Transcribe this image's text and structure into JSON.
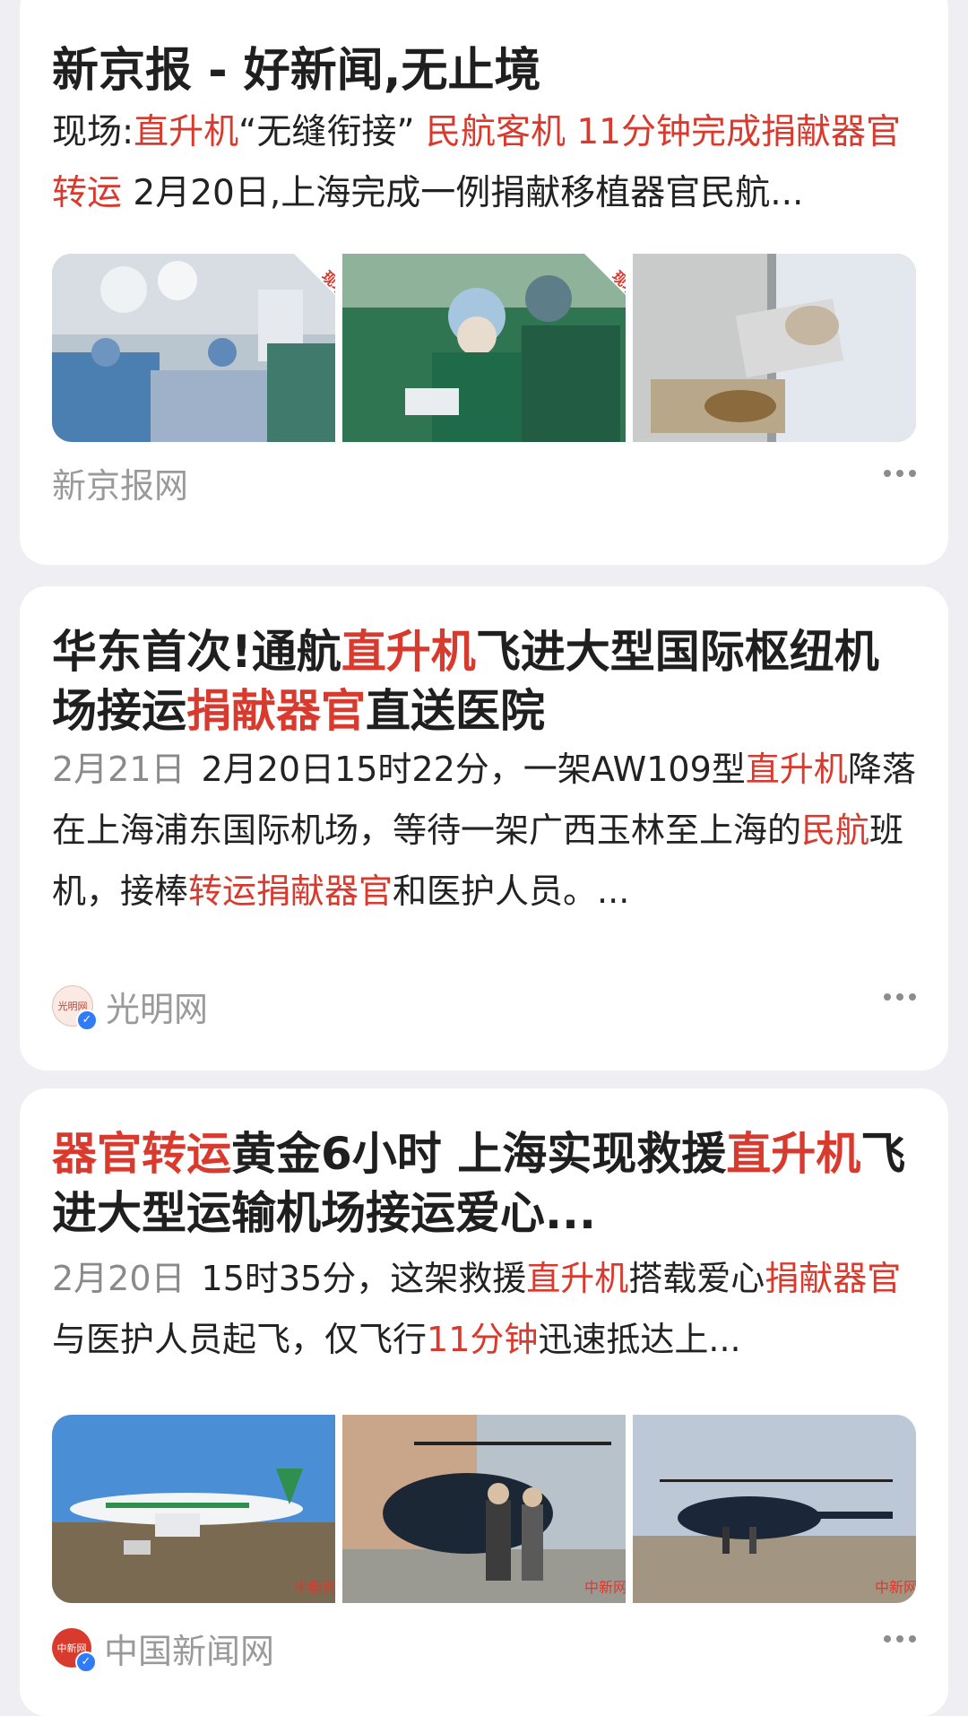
{
  "cards": [
    {
      "title": "新京报 - 好新闻,无止境",
      "snippet": [
        {
          "t": "现场:",
          "hl": false
        },
        {
          "t": "直升机",
          "hl": true
        },
        {
          "t": "“无缝衔接” ",
          "hl": false
        },
        {
          "t": "民航客机 11分钟完成捐献器官转运",
          "hl": true
        },
        {
          "t": " 2月20日,上海完成一例捐献移植器官民航...",
          "hl": false
        }
      ],
      "images": [
        "operating-room-photo",
        "surgeons-photo",
        "organ-tray-photo"
      ],
      "source": "新京报网"
    },
    {
      "title": [
        {
          "t": "华东首次!通航",
          "hl": false
        },
        {
          "t": "直升机",
          "hl": true
        },
        {
          "t": "飞进大型国际枢纽机场接运",
          "hl": false
        },
        {
          "t": "捐献器官",
          "hl": true
        },
        {
          "t": "直送医院",
          "hl": false
        }
      ],
      "date": "2月21日",
      "snippet": [
        {
          "t": "2月20日15时22分，一架AW109型",
          "hl": false
        },
        {
          "t": "直升机",
          "hl": true
        },
        {
          "t": "降落在上海浦东国际机场，等待一架广西玉林至上海的",
          "hl": false
        },
        {
          "t": "民航",
          "hl": true
        },
        {
          "t": "班机，接棒",
          "hl": false
        },
        {
          "t": "转运捐献器官",
          "hl": true
        },
        {
          "t": "和医护人员。...",
          "hl": false
        }
      ],
      "source": "光明网",
      "source_logo_text": "光明网"
    },
    {
      "title": [
        {
          "t": "器官转运",
          "hl": true
        },
        {
          "t": "黄金6小时 上海实现救援",
          "hl": false
        },
        {
          "t": "直升机",
          "hl": true
        },
        {
          "t": "飞进大型运输机场接运爱心...",
          "hl": false
        }
      ],
      "date": "2月20日",
      "snippet": [
        {
          "t": "15时35分，这架救援",
          "hl": false
        },
        {
          "t": "直升机",
          "hl": true
        },
        {
          "t": "搭载爱心",
          "hl": false
        },
        {
          "t": "捐献器官",
          "hl": true
        },
        {
          "t": "与医护人员起飞，仅飞行",
          "hl": false
        },
        {
          "t": "11分钟",
          "hl": true
        },
        {
          "t": "迅速抵达上...",
          "hl": false
        }
      ],
      "images": [
        "airliner-photo",
        "helicopter-boarding-photo",
        "helicopter-apron-photo"
      ],
      "watermark": "中新网",
      "source": "中国新闻网",
      "source_logo_text": "中新网"
    }
  ],
  "colors": {
    "highlight": "#d93a2e",
    "background": "#efeff3",
    "card": "#ffffff"
  }
}
